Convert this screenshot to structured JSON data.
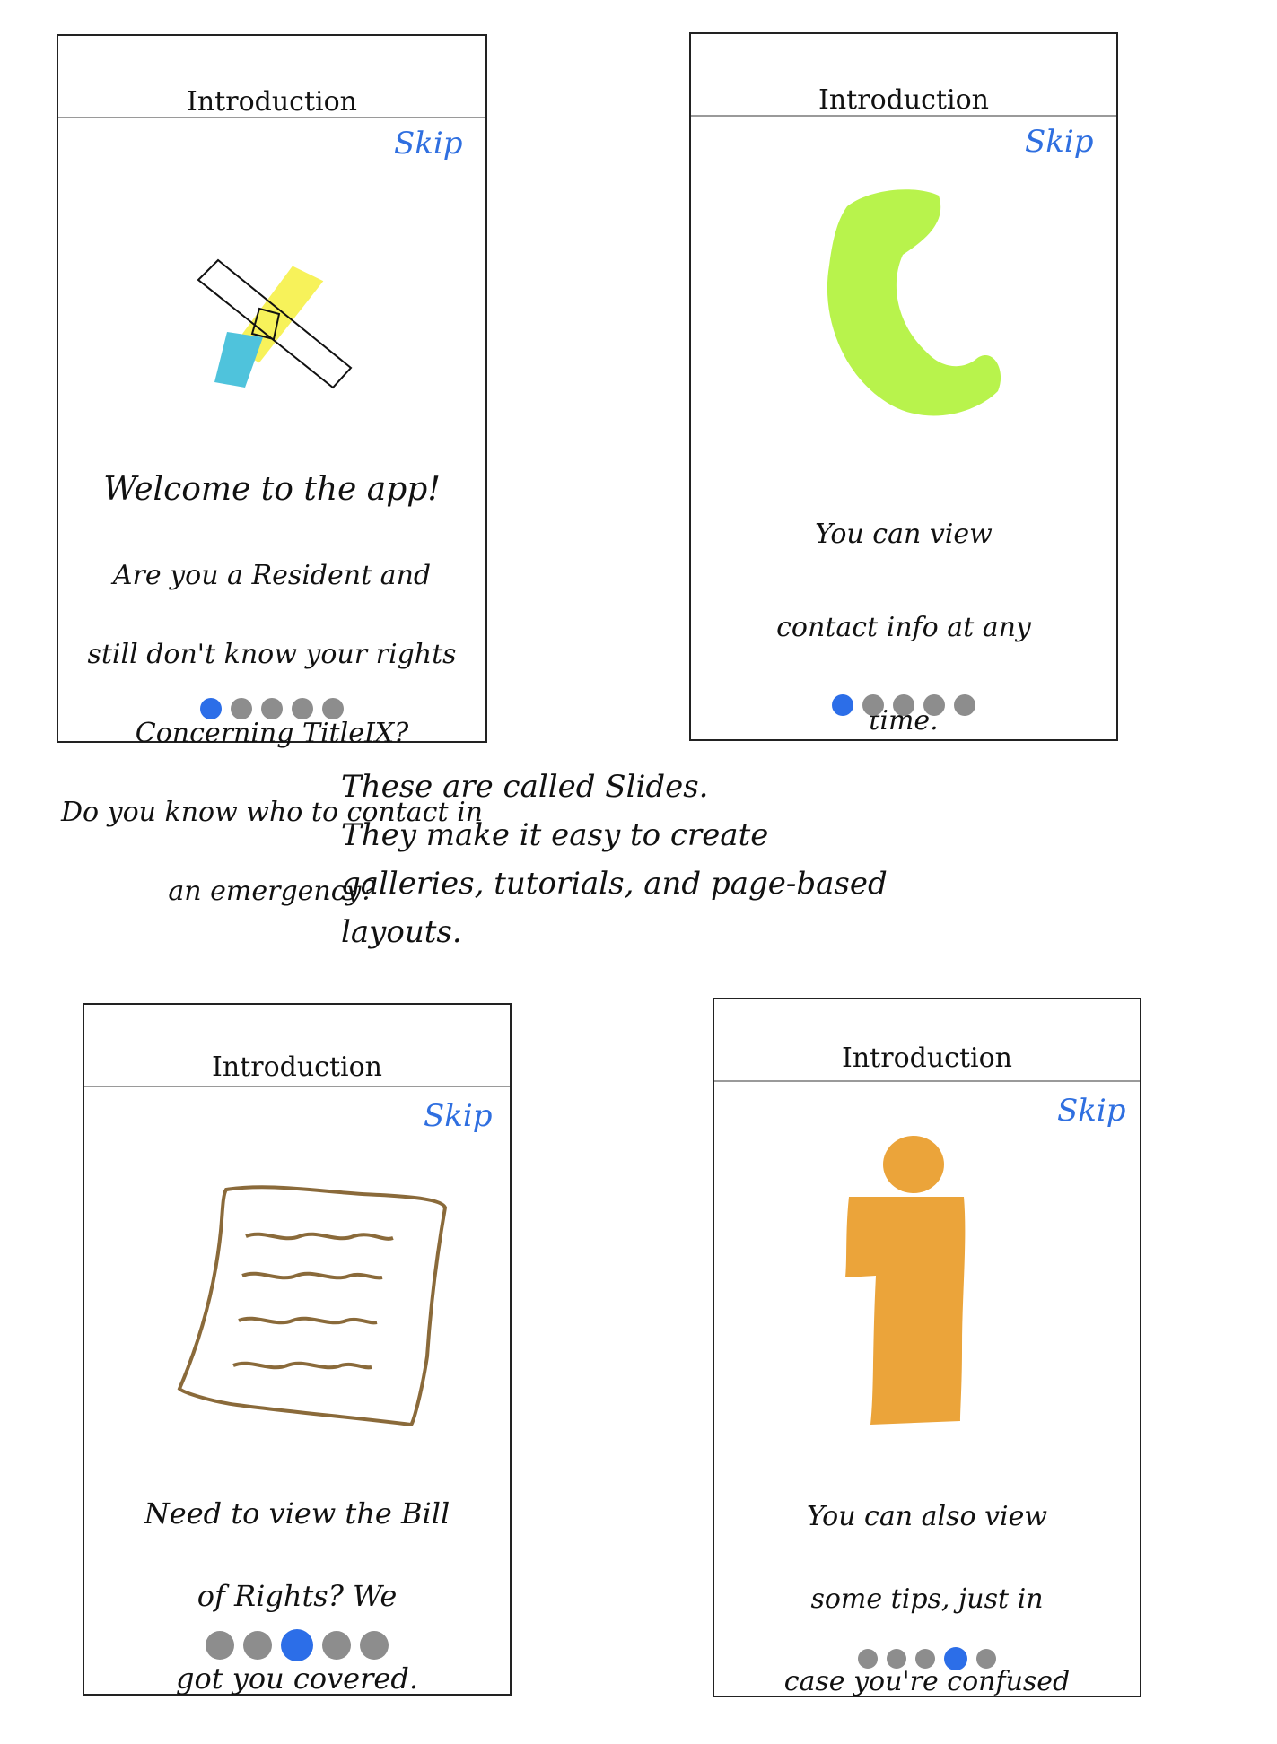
{
  "slides": [
    {
      "title": "Introduction",
      "skip": "Skip",
      "icon": "title-ix-logo-icon",
      "lines": [
        "Welcome to the app!",
        "Are you a Resident and",
        "still don't know your rights",
        "Concerning TitleIX?",
        "Do you know who to contact in",
        "an emergency?"
      ],
      "active_dot": 0,
      "dot_count": 5
    },
    {
      "title": "Introduction",
      "skip": "Skip",
      "icon": "phone-icon",
      "lines": [
        "You can view",
        "contact info at any",
        "time."
      ],
      "active_dot": 0,
      "dot_count": 5
    },
    {
      "title": "Introduction",
      "skip": "Skip",
      "icon": "document-icon",
      "lines": [
        "Need to view the Bill",
        "of Rights? We",
        "got you covered."
      ],
      "active_dot": 2,
      "dot_count": 5
    },
    {
      "title": "Introduction",
      "skip": "Skip",
      "icon": "info-icon",
      "lines": [
        "You can also view",
        "some tips, just in",
        "case you're confused"
      ],
      "active_dot": 3,
      "dot_count": 5
    }
  ],
  "caption": "These are called Slides.\nThey make it easy to create\ngalleries, tutorials, and page-based\nlayouts.",
  "colors": {
    "accent_blue": "#2c6ee8",
    "inactive_dot": "#8d8d8d",
    "title_ix_yellow": "#f7f25a",
    "title_ix_blue": "#4fc3dc",
    "phone_green": "#b8f34c",
    "document_brown": "#8a6a3a",
    "info_orange": "#eba43a"
  }
}
